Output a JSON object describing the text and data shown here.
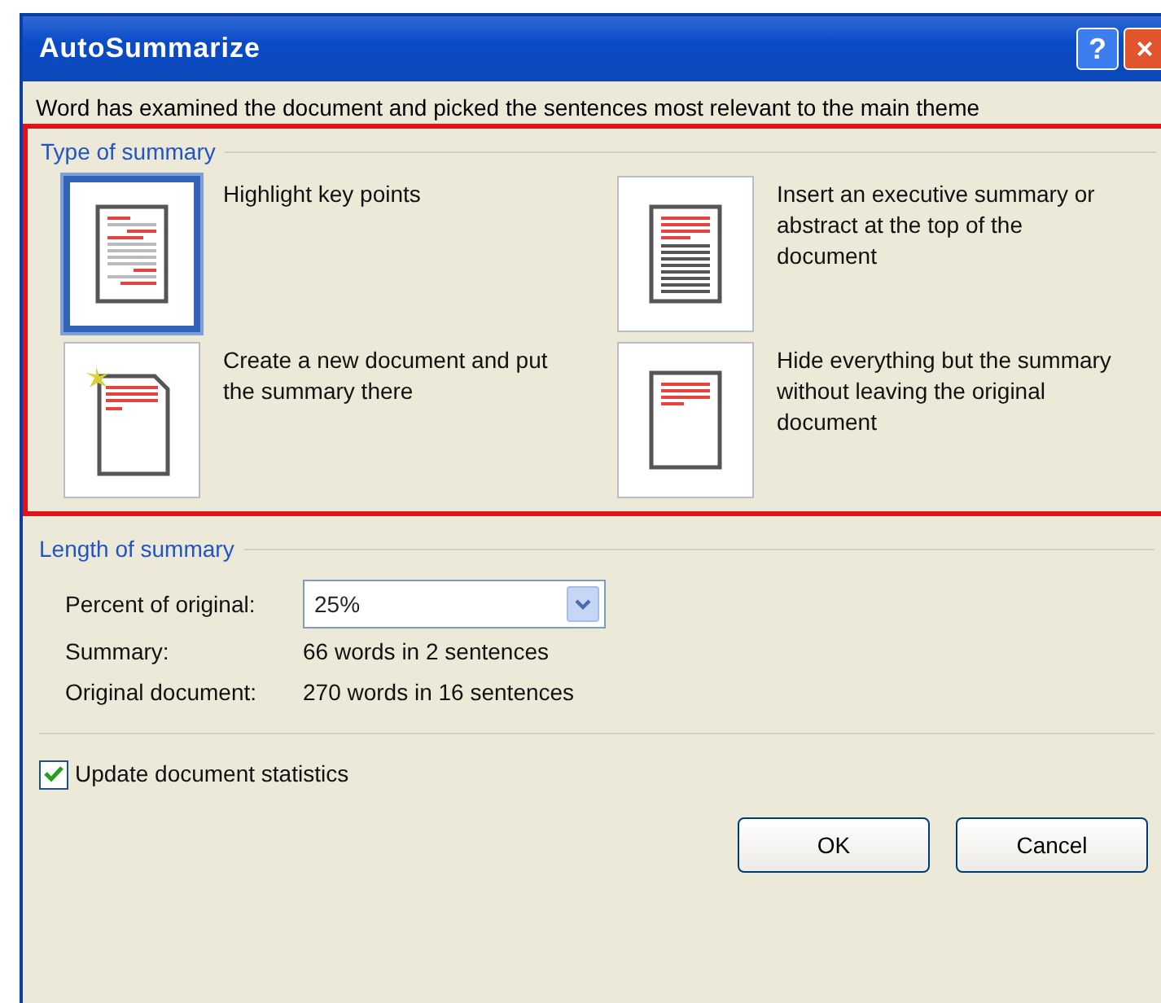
{
  "window": {
    "title": "AutoSummarize",
    "title_buttons": [
      "?",
      "×"
    ]
  },
  "description": "Word has examined the document and picked the sentences most relevant to the main theme",
  "type_of_summary": {
    "label": "Type of summary",
    "options": [
      {
        "kind": "highlight",
        "label": "Highlight key points",
        "selected": true
      },
      {
        "kind": "executive",
        "label": "Insert an executive summary or abstract at the top of the document",
        "selected": false
      },
      {
        "kind": "new-document",
        "label": "Create a new document and put the summary there",
        "selected": false
      },
      {
        "kind": "hide",
        "label": "Hide everything but the summary without leaving the original document",
        "selected": false
      }
    ]
  },
  "length_of_summary": {
    "label": "Length of summary",
    "percent_label": "Percent of original:",
    "percent_value": "25%",
    "stats": [
      {
        "label": "Summary:",
        "value": "66 words in 2 sentences"
      },
      {
        "label": "Original document:",
        "value": "270 words in 16 sentences"
      }
    ]
  },
  "update_statistics": {
    "label": "Update document statistics",
    "checked": true
  },
  "buttons": [
    "OK",
    "Cancel"
  ]
}
